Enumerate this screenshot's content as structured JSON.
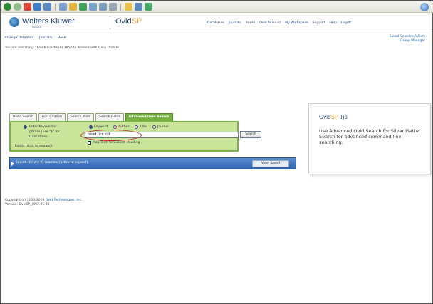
{
  "header": {
    "brand": "Wolters Kluwer",
    "brand_sub": "Health",
    "product_prefix": "Ovid",
    "product_suffix": "SP",
    "nav": [
      "Databases",
      "Journals",
      "Books",
      "Ovid Account",
      "My Workspace",
      "Support",
      "Help",
      "Logoff"
    ]
  },
  "subnav": [
    "Change Database",
    "Journals",
    "Book"
  ],
  "right_links": [
    "Saved Searches/Alerts",
    "Group Manager"
  ],
  "info_line": "You are searching: Ovid MEDLINE(R) 1950 to Present with Daily Update",
  "tabs": [
    {
      "label": "Basic Search",
      "active": false
    },
    {
      "label": "Find Citation",
      "active": false
    },
    {
      "label": "Search Tools",
      "active": false
    },
    {
      "label": "Search Fields",
      "active": false
    },
    {
      "label": "Advanced Ovid Search",
      "active": true
    }
  ],
  "panel": {
    "labels": [
      "Enter Keyword or",
      "phrase (use \"$\" for",
      "truncation)"
    ],
    "radio_options": [
      "Keyword",
      "Author",
      "Title",
      "Journal"
    ],
    "search_value": "head lice rid",
    "search_button": "Search",
    "map_checkbox": "Map Term to Subject Heading",
    "limits_link": "Limits (click to expand)"
  },
  "history": {
    "label": "Search History (0 searches) (click to expand)",
    "button": "View Saved"
  },
  "tip": {
    "title_prefix": "Ovid",
    "title_accent": "SP",
    "title_suffix": " Tip",
    "body": "Use Advanced Ovid Search for Silver Platter Search for advanced command line searching."
  },
  "footer": {
    "line1_prefix": "Copyright (c) 2000-2009",
    "line1_link": "Ovid Technologies, Inc.",
    "line2": "Version: OvidSP_UI02.01.00"
  }
}
